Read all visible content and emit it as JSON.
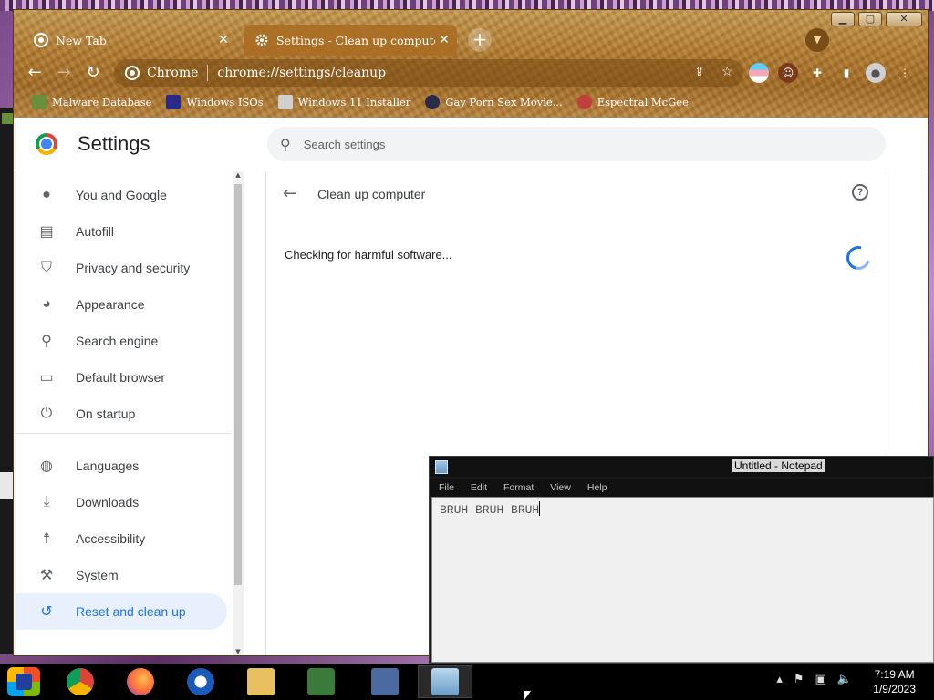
{
  "browser": {
    "tabs": [
      {
        "label": "New Tab",
        "icon": "chrome-icon",
        "active": false
      },
      {
        "label": "Settings - Clean up computer",
        "icon": "gear-icon",
        "active": true
      }
    ],
    "window_controls": {
      "minimize": "▁",
      "maximize": "▢",
      "close": "✕"
    },
    "omnibox": {
      "site_label": "Chrome",
      "url": "chrome://settings/cleanup"
    },
    "bookmarks": [
      {
        "label": "Malware Database",
        "icon_color": "#6a8f3a"
      },
      {
        "label": "Windows ISOs",
        "icon_color": "#2a2a8a"
      },
      {
        "label": "Windows 11 Installer",
        "icon_color": "#d0d0d0"
      },
      {
        "label": "Gay Porn Sex Movie...",
        "icon_color": "#2a2a4a"
      },
      {
        "label": "Espectral McGee",
        "icon_color": "#c04040"
      }
    ]
  },
  "settings": {
    "title": "Settings",
    "search_placeholder": "Search settings",
    "nav": [
      {
        "label": "You and Google",
        "icon": "person-icon"
      },
      {
        "label": "Autofill",
        "icon": "clipboard-icon"
      },
      {
        "label": "Privacy and security",
        "icon": "shield-icon"
      },
      {
        "label": "Appearance",
        "icon": "palette-icon"
      },
      {
        "label": "Search engine",
        "icon": "search-icon"
      },
      {
        "label": "Default browser",
        "icon": "browser-icon"
      },
      {
        "label": "On startup",
        "icon": "power-icon"
      },
      {
        "label": "Languages",
        "icon": "globe-icon"
      },
      {
        "label": "Downloads",
        "icon": "download-icon"
      },
      {
        "label": "Accessibility",
        "icon": "accessibility-icon"
      },
      {
        "label": "System",
        "icon": "wrench-icon"
      },
      {
        "label": "Reset and clean up",
        "icon": "history-icon",
        "selected": true
      }
    ],
    "page": {
      "title": "Clean up computer",
      "status": "Checking for harmful software..."
    }
  },
  "notepad": {
    "title": "Untitled - Notepad",
    "menu": [
      "File",
      "Edit",
      "Format",
      "View",
      "Help"
    ],
    "text": "BRUH BRUH BRUH"
  },
  "taskbar": {
    "items": [
      "Chrome Canary",
      "Chrome",
      "Firefox",
      "Outlook",
      "File Explorer",
      "Network",
      "Control Panel",
      "Notepad"
    ],
    "time": "7:19 AM",
    "date": "1/9/2023"
  },
  "colors": {
    "accent": "#1a73e8",
    "selected_bg": "#e8f0fe",
    "frame": "#b07a30"
  }
}
